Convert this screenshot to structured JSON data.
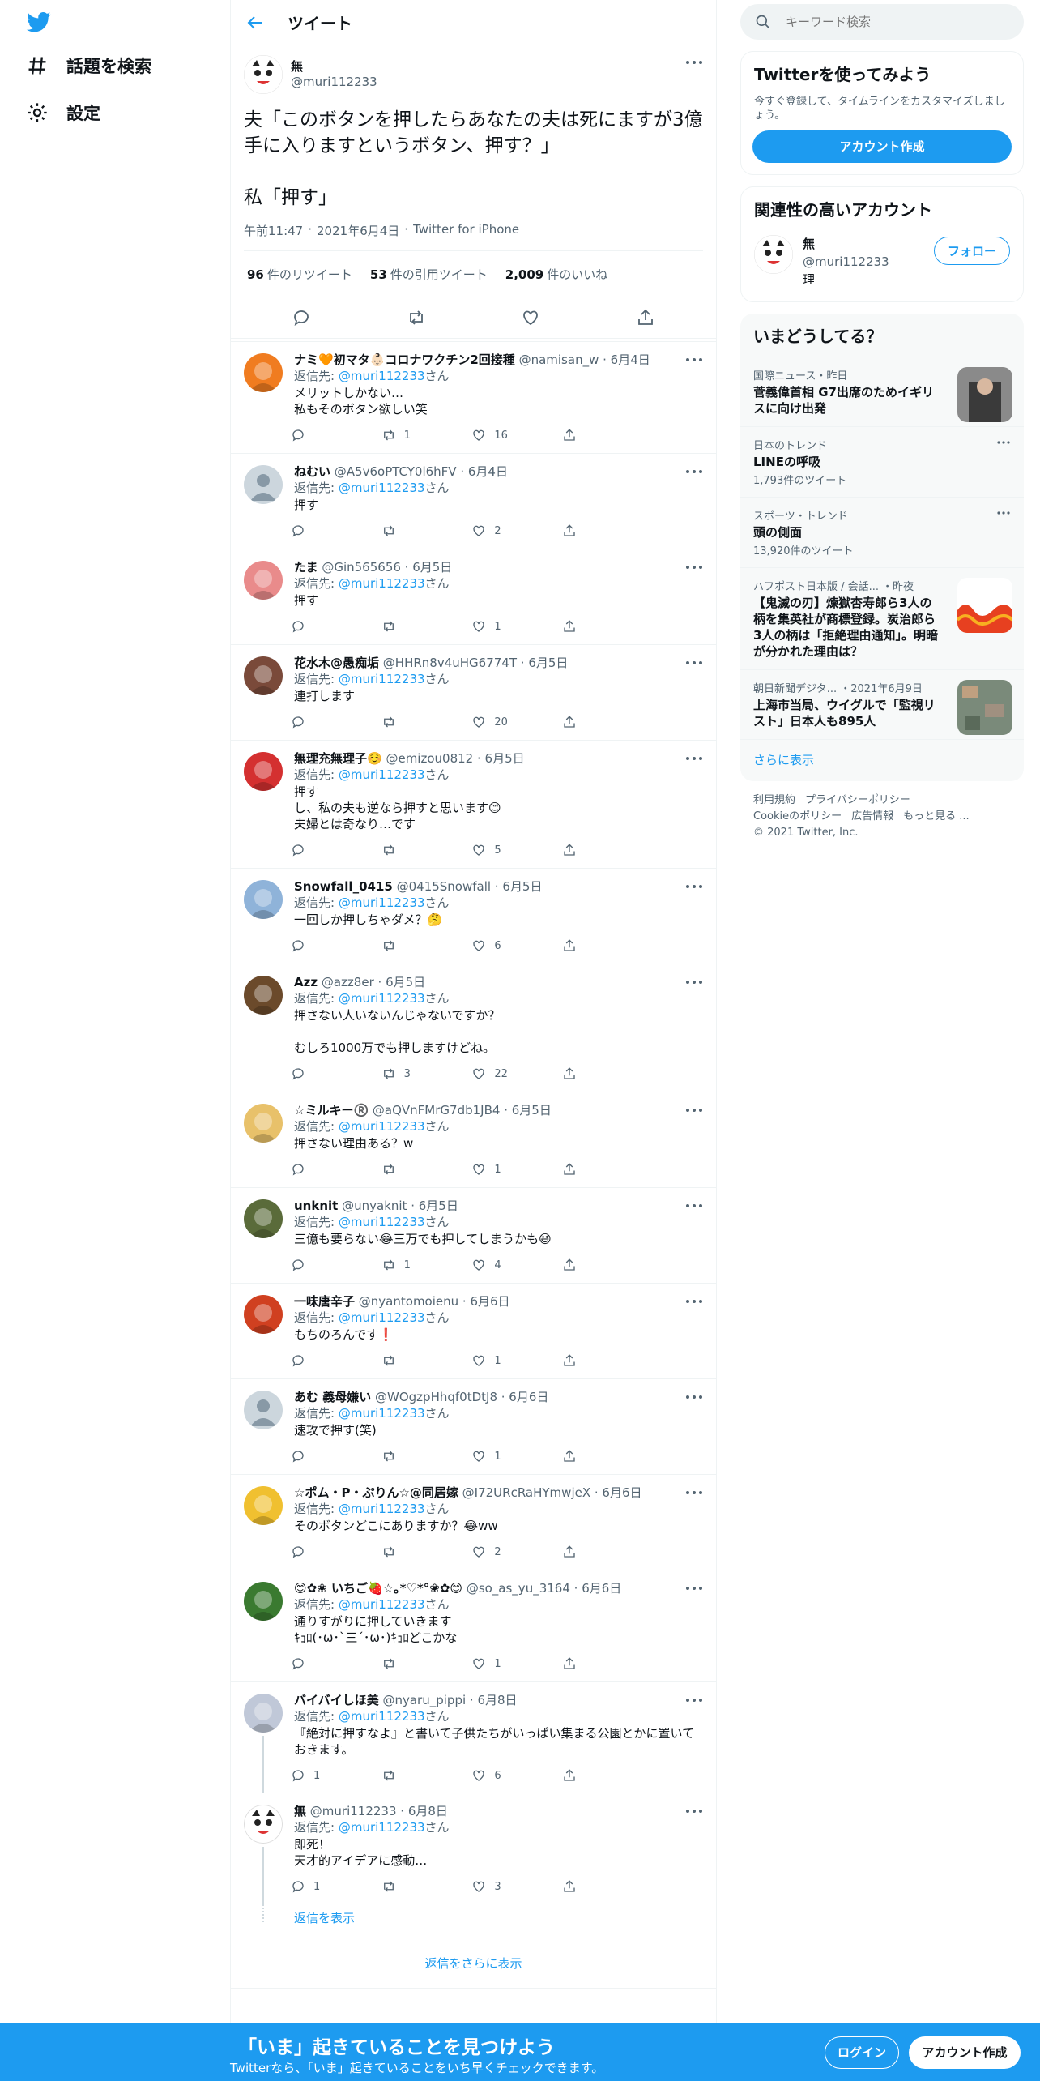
{
  "nav": {
    "explore": "話題を検索",
    "settings": "設定"
  },
  "header": {
    "title": "ツイート"
  },
  "main_tweet": {
    "name": "無",
    "handle": "@muri112233",
    "text": "夫「このボタンを押したらあなたの夫は死にますが3億手に入りますというボタン、押す？」\n\n私「押す」",
    "time": "午前11:47",
    "date": "2021年6月4日",
    "source": "Twitter for iPhone",
    "retweets": "96",
    "retweets_label": "件のリツイート",
    "quotes": "53",
    "quotes_label": "件の引用ツイート",
    "likes": "2,009",
    "likes_label": "件のいいね"
  },
  "reply_to_label": "返信先: ",
  "reply_to_handle": "@muri112233",
  "reply_to_suffix": "さん",
  "replies": [
    {
      "name": "ナミ🧡初マタ👶🏻コロナワクチン2回接種",
      "handle": "@namisan_w",
      "date": "6月4日",
      "text": "メリットしかない…\n私もそのボタン欲しい笑",
      "rt": "1",
      "like": "16",
      "rep": "",
      "color": "#f07c20"
    },
    {
      "name": "ねむい",
      "handle": "@A5v6oPTCY0l6hFV",
      "date": "6月4日",
      "text": "押す",
      "rt": "",
      "like": "2",
      "rep": "",
      "color": "#ccd6dd"
    },
    {
      "name": "たま",
      "handle": "@Gin565656",
      "date": "6月5日",
      "text": "押す",
      "rt": "",
      "like": "1",
      "rep": "",
      "color": "#e98b8b"
    },
    {
      "name": "花水木@愚痴垢",
      "handle": "@HHRn8v4uHG6774T",
      "date": "6月5日",
      "text": "連打します",
      "rt": "",
      "like": "20",
      "rep": "",
      "color": "#7a4a3a"
    },
    {
      "name": "無理充無理子☺️",
      "handle": "@emizou0812",
      "date": "6月5日",
      "text": "押す\nし、私の夫も逆なら押すと思います😊\n夫婦とは奇なり…です",
      "rt": "",
      "like": "5",
      "rep": "",
      "color": "#d43030"
    },
    {
      "name": "Snowfall_0415",
      "handle": "@0415Snowfall",
      "date": "6月5日",
      "text": "一回しか押しちゃダメ？🤔",
      "rt": "",
      "like": "6",
      "rep": "",
      "color": "#8fb3d9"
    },
    {
      "name": "Azz",
      "handle": "@azz8er",
      "date": "6月5日",
      "text": "押さない人いないんじゃないですか？\n\nむしろ1000万でも押しますけどね。",
      "rt": "3",
      "like": "22",
      "rep": "",
      "color": "#6b4a2b"
    },
    {
      "name": "☆ミルキー®️",
      "handle": "@aQVnFMrG7db1JB4",
      "date": "6月5日",
      "text": "押さない理由ある？w",
      "rt": "",
      "like": "1",
      "rep": "",
      "color": "#e8c16a"
    },
    {
      "name": "unknit",
      "handle": "@unyaknit",
      "date": "6月5日",
      "text": "三億も要らない😂三万でも押してしまうかも😆",
      "rt": "1",
      "like": "4",
      "rep": "",
      "color": "#5a6b3a"
    },
    {
      "name": "一味唐辛子",
      "handle": "@nyantomoienu",
      "date": "6月6日",
      "text": "もちのろんです❗️",
      "rt": "",
      "like": "1",
      "rep": "",
      "color": "#d04020"
    },
    {
      "name": "あむ 義母嫌い",
      "handle": "@WOgzpHhqf0tDtJ8",
      "date": "6月6日",
      "text": "速攻で押す(笑)",
      "rt": "",
      "like": "1",
      "rep": "",
      "color": "#ccd6dd"
    },
    {
      "name": "☆ポム・P・ぷりん☆@同居嫁",
      "handle": "@I72URcRaHYmwjeX",
      "date": "6月6日",
      "text": "そのボタンどこにありますか？😂ww",
      "rt": "",
      "like": "2",
      "rep": "",
      "color": "#f0c030"
    },
    {
      "name": "😊✿❀ いちご🍓☆｡*♡*°❀✿😊",
      "handle": "@so_as_yu_3164",
      "date": "6月6日",
      "text": "通りすがりに押していきます\nｷｮﾛ(･ω･`三´･ω･)ｷｮﾛどこかな",
      "rt": "",
      "like": "1",
      "rep": "",
      "color": "#3a7a30"
    },
    {
      "name": "バイバイしほ美",
      "handle": "@nyaru_pippi",
      "date": "6月8日",
      "text": "『絶対に押すなよ』と書いて子供たちがいっぱい集まる公園とかに置いておきます。",
      "rt": "",
      "like": "6",
      "rep": "1",
      "color": "#c0c8d8"
    },
    {
      "name": "無",
      "handle": "@muri112233",
      "date": "6月8日",
      "text": "即死！\n天才的アイデアに感動…",
      "rt": "",
      "like": "3",
      "rep": "1",
      "color": "#ffffff"
    }
  ],
  "show_replies": "返信を表示",
  "show_more_replies": "返信をさらに表示",
  "search": {
    "placeholder": "キーワード検索"
  },
  "join": {
    "title": "Twitterを使ってみよう",
    "desc": "今すぐ登録して、タイムラインをカスタマイズしましょう。",
    "button": "アカウント作成"
  },
  "related": {
    "title": "関連性の高いアカウント",
    "name": "無",
    "handle": "@muri112233",
    "bio": "理",
    "follow": "フォロー"
  },
  "trends": {
    "title": "いまどうしてる？",
    "items": [
      {
        "category": "国際ニュース・昨日",
        "title": "菅義偉首相 G7出席のためイギリスに向け出発",
        "count": ""
      },
      {
        "category": "日本のトレンド",
        "title": "LINEの呼吸",
        "count": "1,793件のツイート"
      },
      {
        "category": "スポーツ・トレンド",
        "title": "頭の側面",
        "count": "13,920件のツイート"
      },
      {
        "category": "ハフポスト日本版 / 会話... ・昨夜",
        "title": "【鬼滅の刃】煉獄杏寿郎ら3人の柄を集英社が商標登録。炭治郎ら3人の柄は「拒絶理由通知」。明暗が分かれた理由は？",
        "count": ""
      },
      {
        "category": "朝日新聞デジタ... ・2021年6月9日",
        "title": "上海市当局、ウイグルで「監視リスト」日本人も895人",
        "count": ""
      }
    ],
    "show_more": "さらに表示"
  },
  "footer": {
    "links": [
      "利用規約",
      "プライバシーポリシー",
      "Cookieのポリシー",
      "広告情報",
      "もっと見る ..."
    ],
    "copyright": "© 2021 Twitter, Inc."
  },
  "bottom_bar": {
    "title": "「いま」起きていることを見つけよう",
    "subtitle": "Twitterなら、「いま」起きていることをいち早くチェックできます。",
    "login": "ログイン",
    "signup": "アカウント作成"
  }
}
